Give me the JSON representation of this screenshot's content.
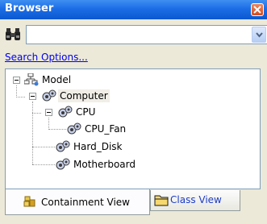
{
  "window": {
    "title": "Browser"
  },
  "search": {
    "value": "",
    "options_link": "Search Options..."
  },
  "tree": {
    "nodes": [
      {
        "label": "Model"
      },
      {
        "label": "Computer"
      },
      {
        "label": "CPU"
      },
      {
        "label": "CPU_Fan"
      },
      {
        "label": "Hard_Disk"
      },
      {
        "label": "Motherboard"
      }
    ]
  },
  "tabs": [
    {
      "label": "Containment View",
      "active": true
    },
    {
      "label": "Class View",
      "active": false
    }
  ],
  "colors": {
    "titlebar": "#0a58d0",
    "link": "#0000ee",
    "close": "#d44a1c"
  }
}
